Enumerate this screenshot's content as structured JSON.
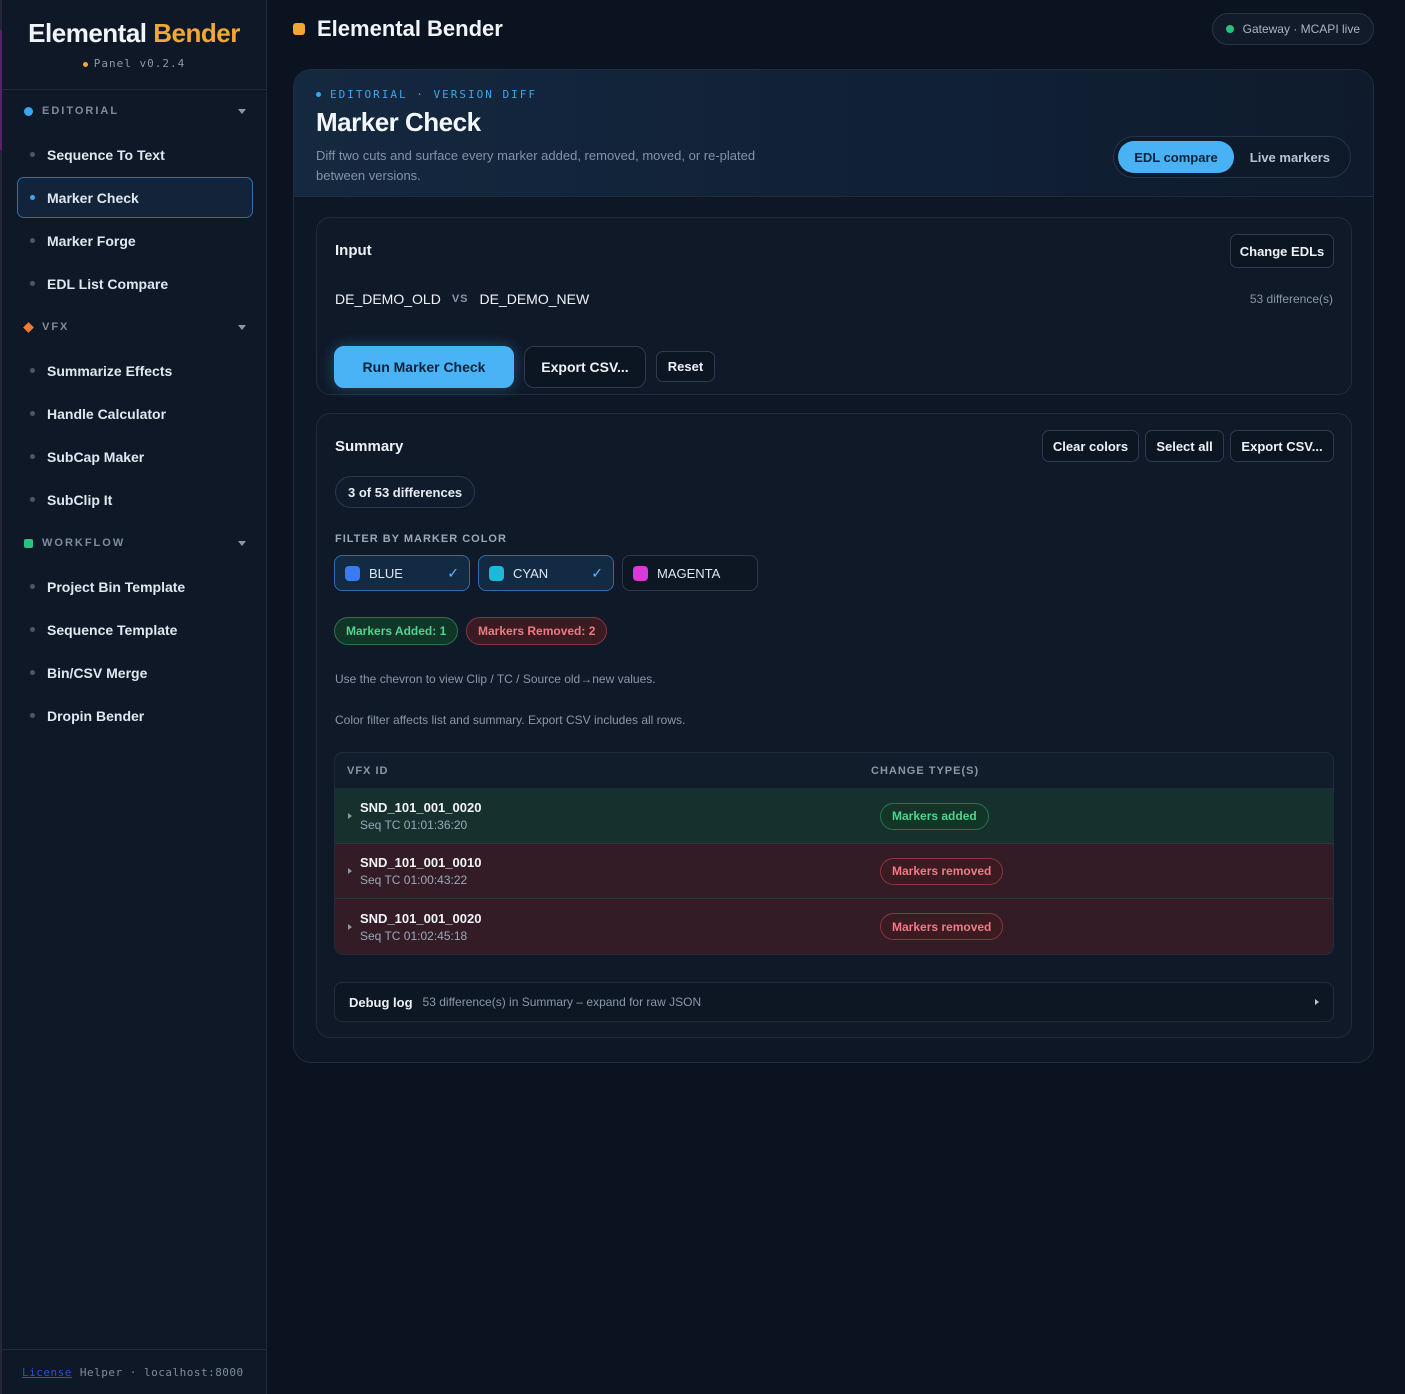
{
  "sidebar": {
    "brand": {
      "name": "Elemental",
      "accent": "Bender",
      "version": "Panel v0.2.4"
    },
    "groups": [
      {
        "label": "EDITORIAL",
        "color": "#3ba5f0",
        "shape": "circle",
        "items": [
          "Sequence To Text",
          "Marker Check",
          "Marker Forge",
          "EDL List Compare"
        ]
      },
      {
        "label": "VFX",
        "color": "#f07d33",
        "shape": "diamond",
        "items": [
          "Summarize Effects",
          "Handle Calculator",
          "SubCap Maker",
          "SubClip It"
        ]
      },
      {
        "label": "WORKFLOW",
        "color": "#26c281",
        "shape": "square",
        "items": [
          "Project Bin Template",
          "Sequence Template",
          "Bin/CSV Merge",
          "Dropin Bender"
        ]
      }
    ],
    "active_item": "Marker Check",
    "footer": {
      "link": "License",
      "text": "Helper · localhost:8000"
    }
  },
  "header": {
    "title": "Elemental Bender",
    "status": "Gateway · MCAPI live",
    "status_color": "#26c281"
  },
  "panel": {
    "crumb": "EDITORIAL · VERSION DIFF",
    "title": "Marker Check",
    "description": "Diff two cuts and surface every marker added, removed, moved, or re-plated between versions.",
    "modes": [
      "EDL compare",
      "Live markers"
    ],
    "active_mode": "EDL compare"
  },
  "input_card": {
    "title": "Input",
    "change_button": "Change EDLs",
    "old_name": "DE_DEMO_OLD",
    "vs": "VS",
    "new_name": "DE_DEMO_NEW",
    "diff_count": "53 difference(s)",
    "run_button": "Run Marker Check",
    "export_button": "Export CSV...",
    "reset_button": "Reset"
  },
  "summary_card": {
    "title": "Summary",
    "buttons": [
      "Clear colors",
      "Select all",
      "Export CSV..."
    ],
    "count_chip": "3 of 53 differences",
    "filter_label": "FILTER BY MARKER COLOR",
    "filters": [
      {
        "label": "BLUE",
        "color": "#3a7cf0",
        "selected": true,
        "check": "✓"
      },
      {
        "label": "CYAN",
        "color": "#1fb8d8",
        "selected": true,
        "check": "✓"
      },
      {
        "label": "MAGENTA",
        "color": "#d63ad9",
        "selected": false,
        "check": ""
      }
    ],
    "tags": [
      "Markers Added: 1",
      "Markers Removed: 2"
    ],
    "hint1": "Use the chevron to view Clip / TC / Source old→new values.",
    "hint2": "Color filter affects list and summary. Export CSV includes all rows.",
    "table": {
      "headers": [
        "VFX ID",
        "CHANGE TYPE(S)"
      ],
      "rows": [
        {
          "id": "SND_101_001_0020",
          "tc": "Seq TC 01:01:36:20",
          "change": "Markers added",
          "kind": "added"
        },
        {
          "id": "SND_101_001_0010",
          "tc": "Seq TC 01:00:43:22",
          "change": "Markers removed",
          "kind": "removed"
        },
        {
          "id": "SND_101_001_0020",
          "tc": "Seq TC 01:02:45:18",
          "change": "Markers removed",
          "kind": "removed"
        }
      ]
    },
    "debug": {
      "title": "Debug log",
      "text": "53 difference(s) in Summary – expand for raw JSON"
    }
  }
}
